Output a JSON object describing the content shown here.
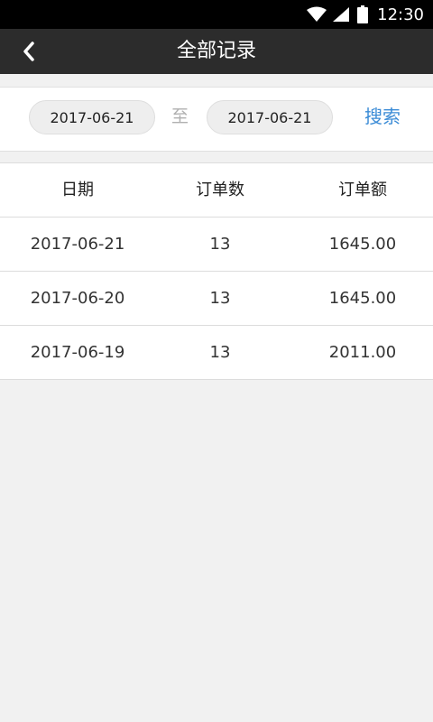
{
  "status_bar": {
    "time": "12:30",
    "icons": [
      "wifi-icon",
      "cell-signal-icon",
      "battery-icon"
    ]
  },
  "header": {
    "back_icon": "chevron-left-icon",
    "title": "全部记录"
  },
  "filter": {
    "start_date": "2017-06-21",
    "separator": "至",
    "end_date": "2017-06-21",
    "search_label": "搜索"
  },
  "table": {
    "columns": [
      "日期",
      "订单数",
      "订单额"
    ],
    "rows": [
      {
        "date": "2017-06-21",
        "orders": "13",
        "amount": "1645.00"
      },
      {
        "date": "2017-06-20",
        "orders": "13",
        "amount": "1645.00"
      },
      {
        "date": "2017-06-19",
        "orders": "13",
        "amount": "2011.00"
      }
    ]
  },
  "colors": {
    "status_bar": "#000000",
    "app_bar": "#2c2c2c",
    "background": "#f1f1f1",
    "accent": "#3a8bd6"
  }
}
